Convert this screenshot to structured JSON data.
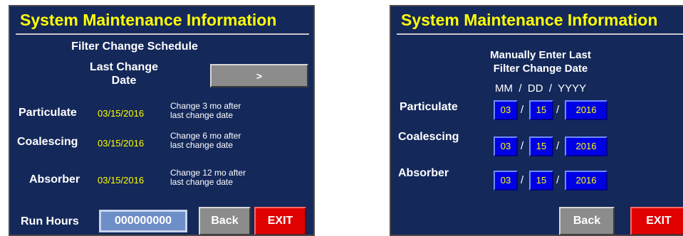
{
  "left": {
    "title": "System Maintenance Information",
    "subtitle": "Filter Change Schedule",
    "last_change_label_line1": "Last Change",
    "last_change_label_line2": "Date",
    "next_button_label": ">",
    "rows": [
      {
        "label": "Particulate",
        "date": "03/15/2016",
        "note_line1": "Change 3 mo after",
        "note_line2": "last change date"
      },
      {
        "label": "Coalescing",
        "date": "03/15/2016",
        "note_line1": "Change 6 mo after",
        "note_line2": "last change date"
      },
      {
        "label": "Absorber",
        "date": "03/15/2016",
        "note_line1": "Change 12 mo after",
        "note_line2": "last change date"
      }
    ],
    "run_hours_label": "Run Hours",
    "run_hours_value": "000000000",
    "back_label": "Back",
    "exit_label": "EXIT"
  },
  "right": {
    "title": "System Maintenance Information",
    "heading_line1": "Manually Enter Last",
    "heading_line2": "Filter Change Date",
    "format_mm": "MM",
    "format_dd": "DD",
    "format_yyyy": "YYYY",
    "separator": "/",
    "rows": [
      {
        "label": "Particulate",
        "mm": "03",
        "dd": "15",
        "yyyy": "2016"
      },
      {
        "label": "Coalescing",
        "mm": "03",
        "dd": "15",
        "yyyy": "2016"
      },
      {
        "label": "Absorber",
        "mm": "03",
        "dd": "15",
        "yyyy": "2016"
      }
    ],
    "back_label": "Back",
    "exit_label": "EXIT"
  },
  "colors": {
    "panel_bg": "#14285a",
    "title_yellow": "#ffff00",
    "button_gray": "#8c8c8c",
    "exit_red": "#e00000",
    "date_box_blue": "#0000e6"
  }
}
